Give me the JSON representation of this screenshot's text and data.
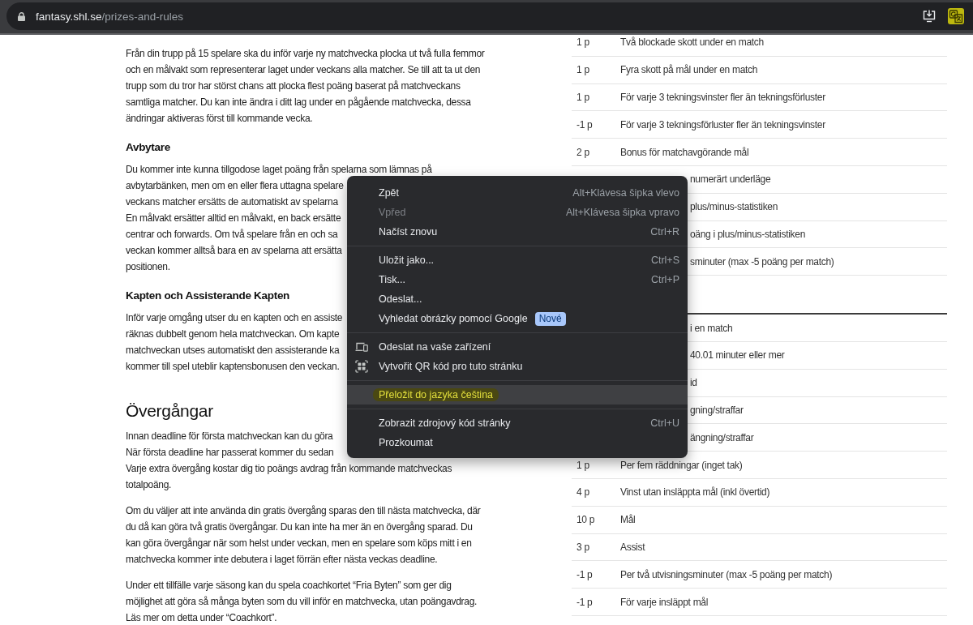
{
  "browser": {
    "address": {
      "host": "fantasy.shl.se",
      "path": "/prizes-and-rules"
    },
    "toolbar_icons": [
      {
        "kind": "install",
        "marked": false
      },
      {
        "kind": "translate",
        "marked": true
      }
    ]
  },
  "article": [
    {
      "kind": "paragraph",
      "text": "Från din trupp på 15 spelare ska du inför varje ny matchvecka plocka ut två fulla femmor och en målvakt som representerar laget under veckans alla matcher. Se till att ta ut den trupp som du tror har störst chans att plocka flest poäng baserat på matchveckans samtliga matcher. Du kan inte ändra i ditt lag under en pågående matchvecka, dessa ändringar aktiveras först till kommande vecka."
    },
    {
      "kind": "subheading",
      "text": "Avbytare"
    },
    {
      "kind": "clipped",
      "lines": [
        "Du kommer inte kunna tillgodose laget poäng från spelarna som lämnas på",
        "avbytarbänken, men om en eller flera uttagna spelare",
        "veckans matcher ersätts de automatiskt av spelarna",
        "En målvakt ersätter alltid en målvakt, en back ersätte",
        "centrar och forwards. Om två spelare från en och sa",
        "veckan kommer alltså bara en av spelarna att ersätta",
        "positionen."
      ]
    },
    {
      "kind": "subheading",
      "text": "Kapten och Assisterande Kapten"
    },
    {
      "kind": "clipped",
      "lines": [
        "Inför varje omgång utser du en kapten och en assiste",
        "räknas dubbelt genom hela matchveckan. Om kapte",
        "matchveckan utses automatiskt den assisterande ka",
        "kommer till spel uteblir kaptensbonusen den veckan."
      ]
    },
    {
      "kind": "heading",
      "text": "Övergångar"
    },
    {
      "kind": "clipped",
      "lines": [
        "Innan deadline för första matchveckan kan du göra",
        "När första deadline har passerat kommer du sedan",
        "Varje extra övergång kostar dig tio poängs avdrag från kommande matchveckas",
        "totalpoäng."
      ]
    },
    {
      "kind": "paragraph",
      "text": "Om du väljer att inte använda din gratis övergång sparas den till nästa matchvecka, där du då kan göra två gratis övergångar. Du kan inte ha mer än en övergång sparad. Du kan göra övergångar när som helst under veckan, men en spelare som köps mitt i en matchvecka kommer inte debutera i laget förrän efter nästa veckas deadline."
    },
    {
      "kind": "paragraph",
      "text": "Under ett tillfälle varje säsong kan du spela coachkortet “Fria Byten” som ger dig möjlighet att göra så många byten som du vill inför en matchvecka, utan poängavdrag. Läs mer om detta under “Coachkort”."
    }
  ],
  "scoring_tables": [
    {
      "rows": [
        {
          "kind": "full",
          "points": "1 p",
          "description": "Två blockade skott under en match"
        },
        {
          "kind": "full",
          "points": "1 p",
          "description": "Fyra skott på mål under en match"
        },
        {
          "kind": "full",
          "points": "1 p",
          "description": "För varje 3 tekningsvinster fler än tekningsförluster"
        },
        {
          "kind": "full",
          "points": "-1 p",
          "description": "För varje 3 tekningsförluster fler än tekningsvinster"
        },
        {
          "kind": "full",
          "points": "2 p",
          "description": "Bonus för matchavgörande mål"
        },
        {
          "kind": "partial",
          "description": "numerärt underläge"
        },
        {
          "kind": "partial",
          "description": "plus/minus-statistiken"
        },
        {
          "kind": "partial",
          "description": "oäng i plus/minus-statistiken"
        },
        {
          "kind": "partial",
          "description": "sminuter (max -5 poäng per match)"
        }
      ]
    },
    {
      "rows": [
        {
          "kind": "partial",
          "description": "i en match"
        },
        {
          "kind": "partial",
          "description": "40.01 minuter eller mer"
        },
        {
          "kind": "partial",
          "description": "id"
        },
        {
          "kind": "partial",
          "description": "gning/straffar"
        },
        {
          "kind": "partial",
          "description": "ängning/straffar"
        },
        {
          "kind": "full",
          "points": "1 p",
          "description": "Per fem räddningar (inget tak)"
        },
        {
          "kind": "full",
          "points": "4 p",
          "description": "Vinst utan insläppta mål (inkl övertid)"
        },
        {
          "kind": "full",
          "points": "10 p",
          "description": "Mål"
        },
        {
          "kind": "full",
          "points": "3 p",
          "description": "Assist"
        },
        {
          "kind": "full",
          "points": "-1 p",
          "description": "Per två utvisningsminuter (max -5 poäng per match)"
        },
        {
          "kind": "full",
          "points": "-1 p",
          "description": "För varje insläppt mål"
        }
      ]
    }
  ],
  "context_menu": {
    "groups": [
      [
        {
          "kind": "plain",
          "label": "Zpět",
          "shortcut": "Alt+Klávesa šipka vlevo",
          "disabled": false,
          "selected": false,
          "marked": false
        },
        {
          "kind": "plain",
          "label": "Vpřed",
          "shortcut": "Alt+Klávesa šipka vpravo",
          "disabled": true,
          "selected": false,
          "marked": false
        },
        {
          "kind": "plain",
          "label": "Načíst znovu",
          "shortcut": "Ctrl+R",
          "disabled": false,
          "selected": false,
          "marked": false
        }
      ],
      [
        {
          "kind": "plain",
          "label": "Uložit jako...",
          "shortcut": "Ctrl+S",
          "disabled": false,
          "selected": false,
          "marked": false
        },
        {
          "kind": "plain",
          "label": "Tisk...",
          "shortcut": "Ctrl+P",
          "disabled": false,
          "selected": false,
          "marked": false
        },
        {
          "kind": "plain",
          "label": "Odeslat...",
          "disabled": false,
          "selected": false,
          "marked": false
        },
        {
          "kind": "plain",
          "label": "Vyhledat obrázky pomocí Google",
          "badge": "Nové",
          "disabled": false,
          "selected": false,
          "marked": false
        }
      ],
      [
        {
          "kind": "device",
          "label": "Odeslat na vaše zařízení",
          "disabled": false,
          "selected": false,
          "marked": false
        },
        {
          "kind": "qr",
          "label": "Vytvořit QR kód pro tuto stránku",
          "disabled": false,
          "selected": false,
          "marked": false
        }
      ],
      [
        {
          "kind": "plain",
          "label": "Přeložit do jazyka čeština",
          "disabled": false,
          "selected": true,
          "marked": true
        }
      ],
      [
        {
          "kind": "plain",
          "label": "Zobrazit zdrojový kód stránky",
          "shortcut": "Ctrl+U",
          "disabled": false,
          "selected": false,
          "marked": false
        },
        {
          "kind": "plain",
          "label": "Prozkoumat",
          "disabled": false,
          "selected": false,
          "marked": false
        }
      ]
    ]
  }
}
